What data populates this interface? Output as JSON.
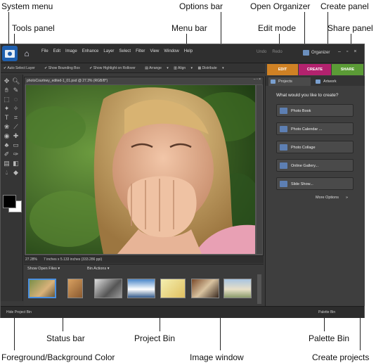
{
  "callouts": {
    "system_menu": "System menu",
    "tools_panel": "Tools panel",
    "options_bar": "Options bar",
    "menu_bar": "Menu bar",
    "open_organizer": "Open Organizer",
    "create_panel": "Create panel",
    "edit_mode": "Edit mode",
    "share_panel": "Share panel",
    "status_bar": "Status bar",
    "project_bin": "Project Bin",
    "palette_bin": "Palette Bin",
    "fg_bg_color": "Foreground/Background Color",
    "image_window": "Image window",
    "create_projects": "Create projects"
  },
  "menubar": {
    "items": [
      "File",
      "Edit",
      "Image",
      "Enhance",
      "Layer",
      "Select",
      "Filter",
      "View",
      "Window",
      "Help"
    ],
    "undo": "Undo",
    "redo": "Redo",
    "organizer": "Organizer"
  },
  "options_bar": {
    "auto_select": "Auto Select Layer",
    "show_bounding": "Show Bounding Box",
    "show_highlight": "Show Highlight on Rollover",
    "arrange": "Arrange",
    "align": "Align",
    "distribute": "Distribute"
  },
  "mode_tabs": {
    "edit": "EDIT",
    "create": "CREATE",
    "share": "SHARE"
  },
  "image_window": {
    "title": "photoCourtney_edited-1_01.psd @ 27.3% (RGB/8*)"
  },
  "status_bar": {
    "zoom": "27.28%",
    "dimensions": "7 inches x 5.133 inches (333.286 ppi)"
  },
  "project_bin": {
    "show_open_files": "Show Open Files",
    "bin_actions": "Bin Actions"
  },
  "bottom_bar": {
    "hide_project_bin": "Hide Project Bin",
    "palette_bin": "Palette Bin"
  },
  "palette": {
    "tab_projects": "Projects",
    "tab_artwork": "Artwork",
    "heading": "What would you like to create?",
    "buttons": [
      "Photo Book",
      "Photo Calendar ...",
      "Photo Collage",
      "Online Gallery...",
      "Slide Show..."
    ],
    "more_options": "More Options"
  },
  "colors": {
    "edit_tab": "#cf8124",
    "create_tab": "#b3226e",
    "share_tab": "#5b9b36",
    "app_background": "#3a3a3a"
  }
}
